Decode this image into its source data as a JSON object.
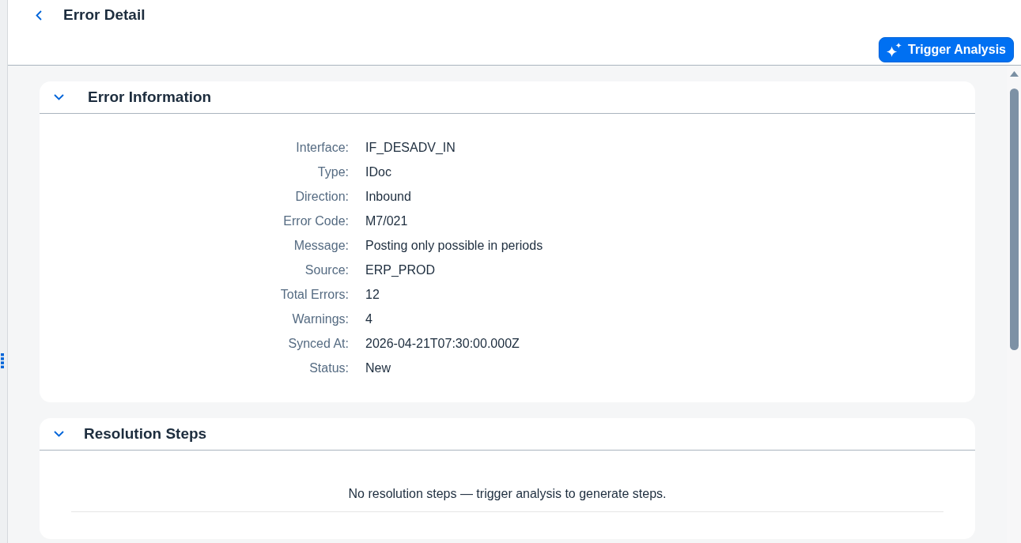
{
  "header": {
    "title": "Error Detail",
    "actions": [
      {
        "label": "Trigger Analysis",
        "kind": "ai"
      }
    ]
  },
  "sections": [
    {
      "title": "Error Information",
      "expanded": true,
      "kind": "fields",
      "fields": [
        {
          "label": "Interface:",
          "value": "IF_DESADV_IN"
        },
        {
          "label": "Type:",
          "value": "IDoc"
        },
        {
          "label": "Direction:",
          "value": "Inbound"
        },
        {
          "label": "Error Code:",
          "value": "M7/021"
        },
        {
          "label": "Message:",
          "value": "Posting only possible in periods"
        },
        {
          "label": "Source:",
          "value": "ERP_PROD"
        },
        {
          "label": "Total Errors:",
          "value": "12"
        },
        {
          "label": "Warnings:",
          "value": "4"
        },
        {
          "label": "Synced At:",
          "value": "2026-04-21T07:30:00.000Z"
        },
        {
          "label": "Status:",
          "value": "New"
        }
      ]
    },
    {
      "title": "Resolution Steps",
      "expanded": true,
      "kind": "empty",
      "message": "No resolution steps — trigger analysis to generate steps."
    }
  ]
}
